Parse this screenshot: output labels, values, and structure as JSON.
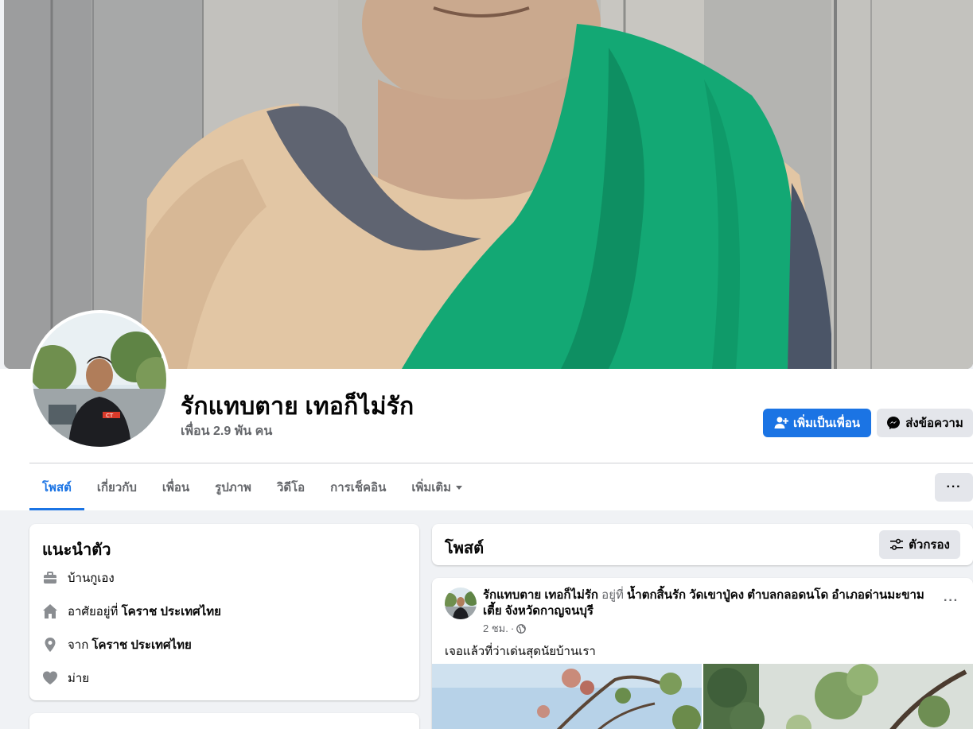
{
  "profile": {
    "name": "รักแทบตาย เทอก็ไม่รัก",
    "friends": "เพื่อน 2.9 พัน คน"
  },
  "actions": {
    "add_friend": "เพิ่มเป็นเพื่อน",
    "message": "ส่งข้อความ"
  },
  "tabs": [
    {
      "label": "โพสต์",
      "active": true
    },
    {
      "label": "เกี่ยวกับ"
    },
    {
      "label": "เพื่อน"
    },
    {
      "label": "รูปภาพ"
    },
    {
      "label": "วิดีโอ"
    },
    {
      "label": "การเช็คอิน"
    },
    {
      "label": "เพิ่มเติม"
    }
  ],
  "more_button": "···",
  "intro": {
    "title": "แนะนำตัว",
    "work": "บ้านกูเอง",
    "lives_prefix": "อาศัยอยู่ที่ ",
    "lives_place": "โคราช ประเทศไทย",
    "from_prefix": "จาก ",
    "from_place": "โคราช ประเทศไทย",
    "relationship": "ม่าย"
  },
  "posts_section": {
    "title": "โพสต์",
    "filter": "ตัวกรอง"
  },
  "post": {
    "author": "รักแทบตาย เทอก็ไม่รัก",
    "at": " อยู่ที่ ",
    "location": "น้ำตกสิ้นรัก วัดเขาปู่คง ตำบลกลอดนโด อำเภอด่านมะขามเตี้ย จังหวัดกาญจนบุรี",
    "time": "2 ชม.",
    "sep": "·",
    "text": "เจอแล้วที่ว่าเด่นสุดนัยบ้านเรา",
    "dots": "···"
  },
  "colors": {
    "accent": "#1b74e4",
    "background": "#f0f2f5",
    "secondary_button": "#e4e6eb"
  },
  "icons": [
    "add-friend-icon",
    "messenger-icon",
    "briefcase-icon",
    "home-icon",
    "location-pin-icon",
    "heart-icon",
    "filter-icon",
    "globe-icon",
    "chevron-down-icon"
  ]
}
